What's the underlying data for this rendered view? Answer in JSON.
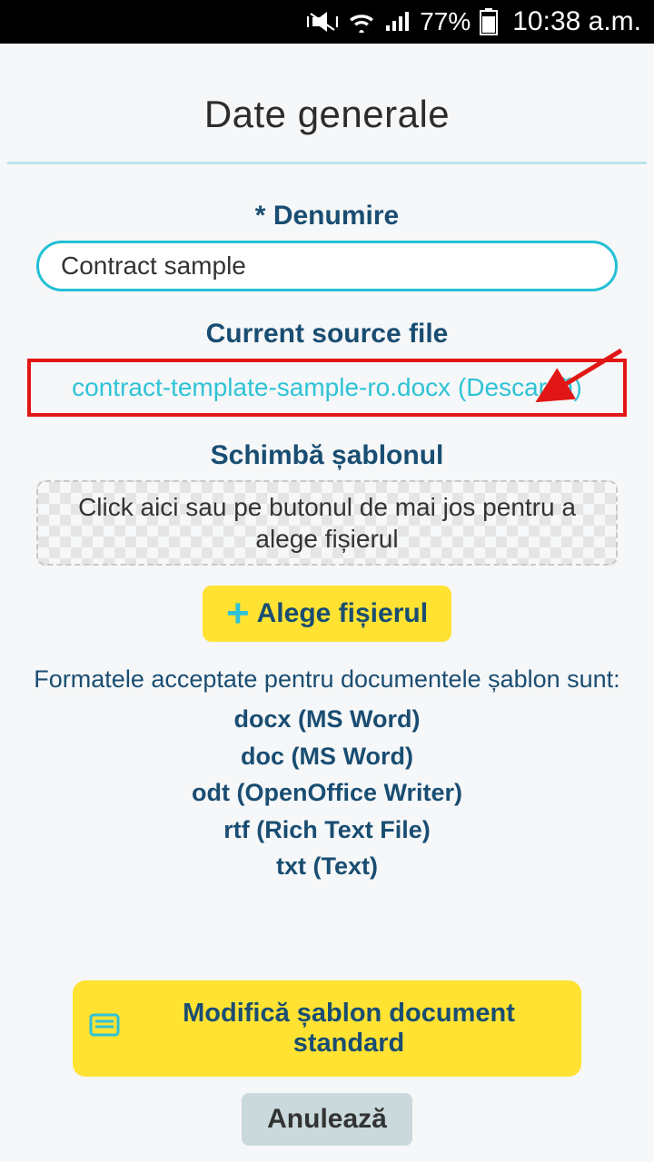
{
  "status": {
    "battery": "77%",
    "clock": "10:38 a.m."
  },
  "page_title": "Date generale",
  "name_field": {
    "label": "Denumire",
    "value": "Contract sample"
  },
  "source": {
    "label": "Current source file",
    "filename": "contract-template-sample-ro.docx",
    "download": "Descarcă"
  },
  "change": {
    "label": "Schimbă șablonul",
    "dropzone": "Click aici sau pe butonul de mai jos pentru a alege fișierul",
    "button": "Alege fișierul"
  },
  "formats": {
    "intro": "Formatele acceptate pentru documentele șablon sunt:",
    "items": [
      "docx (MS Word)",
      "doc (MS Word)",
      "odt (OpenOffice Writer)",
      "rtf (Rich Text File)",
      "txt (Text)"
    ]
  },
  "footer": {
    "modify": "Modifică șablon document standard",
    "cancel": "Anulează"
  }
}
